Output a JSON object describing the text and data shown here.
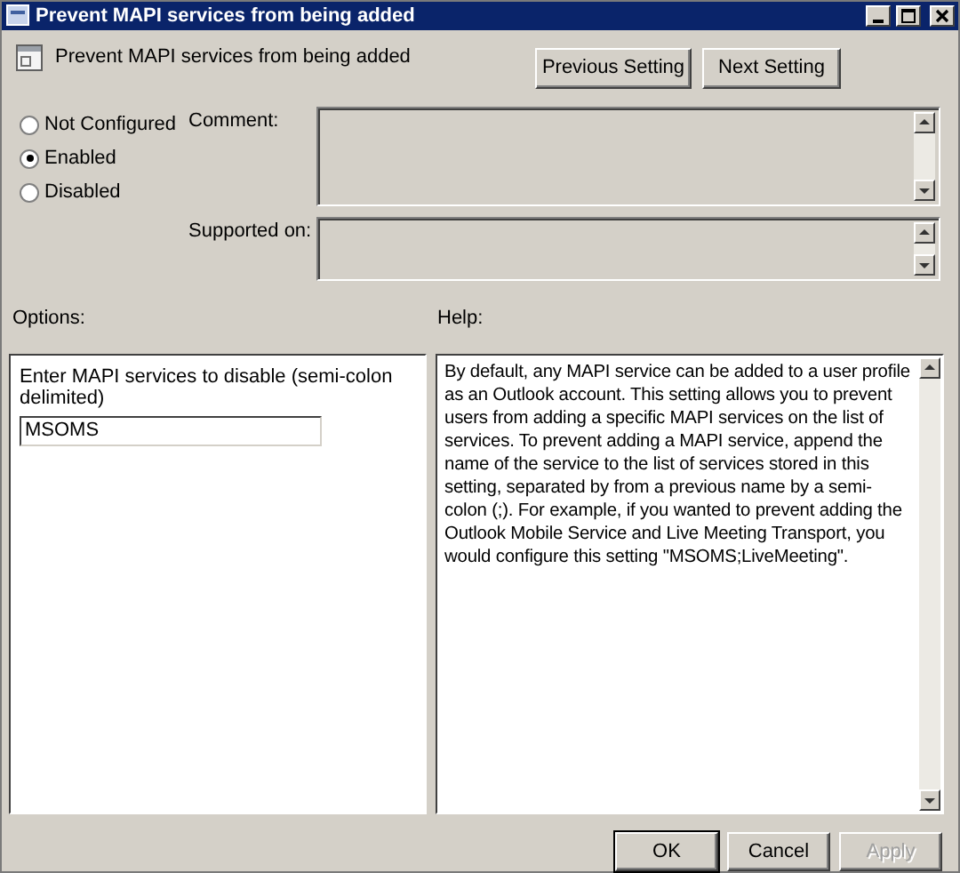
{
  "window": {
    "title": "Prevent MAPI services from being added"
  },
  "header": {
    "title": "Prevent MAPI services from being added",
    "nav_buttons": [
      "Previous Setting",
      "Next Setting"
    ]
  },
  "states": [
    {
      "label": "Not Configured",
      "selected": false
    },
    {
      "label": "Enabled",
      "selected": true
    },
    {
      "label": "Disabled",
      "selected": false
    }
  ],
  "comment": {
    "label": "Comment:"
  },
  "supported_on": {
    "label": "Supported on:"
  },
  "options": {
    "label": "Options:",
    "prompt": "Enter MAPI services to disable (semi-colon delimited)",
    "value": "MSOMS"
  },
  "help": {
    "label": "Help:",
    "text": "By default, any MAPI service can be added to a user profile as an Outlook account. This setting allows you to prevent users from adding a specific MAPI services on the list of services. To prevent adding a MAPI service, append the name of the service to the list of services stored in this setting, separated by from a previous name by a semi-colon (;). For example, if you wanted to prevent adding the Outlook Mobile Service and Live Meeting Transport, you would configure this setting \"MSOMS;LiveMeeting\"."
  },
  "buttons": [
    {
      "label": "OK",
      "disabled": false,
      "default": true
    },
    {
      "label": "Cancel",
      "disabled": false,
      "default": false
    },
    {
      "label": "Apply",
      "disabled": true,
      "default": false
    }
  ]
}
